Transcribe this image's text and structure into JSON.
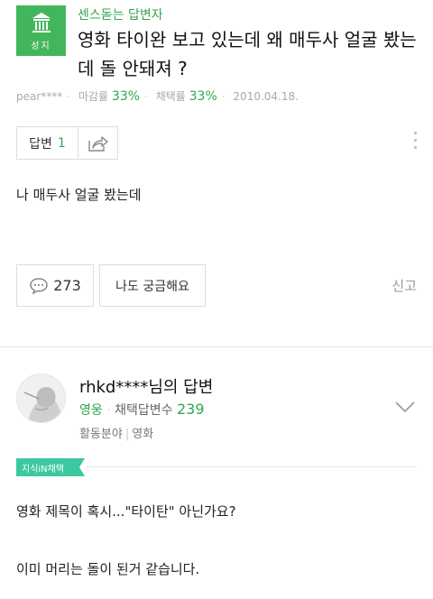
{
  "question": {
    "badge_label": "성지",
    "category": "센스돋는 답변자",
    "title": "영화 타이완 보고 있는데 왜 매두사 얼굴 봤는데 돌 안돼져 ?",
    "author": "pear****",
    "closing_rate_label": "마감률",
    "closing_rate": "33%",
    "adoption_rate_label": "채택률",
    "adoption_rate": "33%",
    "date": "2010.04.18.",
    "answer_label": "답변",
    "answer_count": "1",
    "body": "나 매두사 얼굴 봤는데",
    "comment_count": "273",
    "curious_label": "나도 궁금해요",
    "report_label": "신고"
  },
  "answer": {
    "name": "rhkd****님의 답변",
    "rank": "영웅",
    "adopted_label": "채택답변수",
    "adopted_count": "239",
    "field_label": "활동분야",
    "field_value": "영화",
    "chosen_tag": "지식iN채택",
    "line1": "영화 제목이 혹시...\"타이탄\" 아닌가요?",
    "line2": "이미 머리는 돌이 된거 같습니다."
  },
  "colors": {
    "accent_green": "#43b65b",
    "text_green": "#2fa84f",
    "tag_green": "#3cc8a0"
  }
}
